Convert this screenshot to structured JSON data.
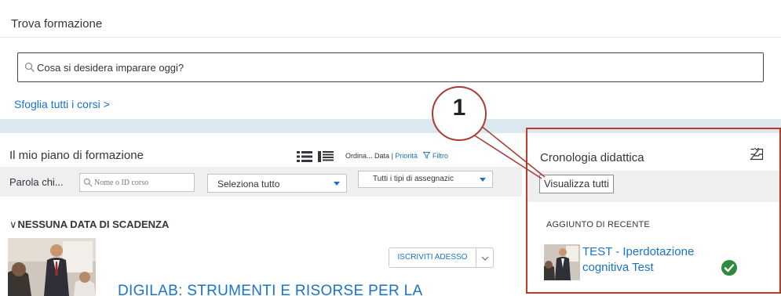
{
  "find": {
    "title": "Trova formazione",
    "search_placeholder": "Cosa si desidera imparare oggi?",
    "browse_link": "Sfoglia tutti i corsi",
    "browse_chevron": ">"
  },
  "plan": {
    "title": "Il mio piano di formazione",
    "sort_label": "Ordina...",
    "sort_date": "Data",
    "sort_sep": "|",
    "sort_priority": "Priorità",
    "filter_label": "Filtro",
    "keyword_label": "Parola chi...",
    "course_input_placeholder": "Nome o ID corso",
    "select_all": "Seleziona tutto",
    "assignment_types": "Tutti i tipi di assegnazic",
    "section_chevron": "∨",
    "section_header": "NESSUNA DATA DI SCADENZA",
    "enroll_button": "ISCRIVITI ADESSO",
    "course_title": "DIGILAB: STRUMENTI E RISORSE PER LA"
  },
  "history": {
    "title": "Cronologia didattica",
    "view_all": "Visualizza tutti",
    "recent_label": "AGGIUNTO DI RECENTE",
    "item_title": "TEST - Iperdotazione cognitiva Test",
    "item_status": "completed"
  },
  "callout": {
    "number": "1"
  },
  "colors": {
    "accent_blue": "#1a73c9",
    "highlight_frame": "#c0392b",
    "completed_green": "#2e8b3e",
    "band": "#dbe8ef",
    "toolbar_grey": "#edeff0"
  },
  "icons": {
    "search": "search-icon",
    "list_view": "list-view-icon",
    "compact_view": "compact-list-view-icon",
    "filter": "filter-icon",
    "history": "history-tray-icon",
    "completed": "check-circle-icon"
  }
}
